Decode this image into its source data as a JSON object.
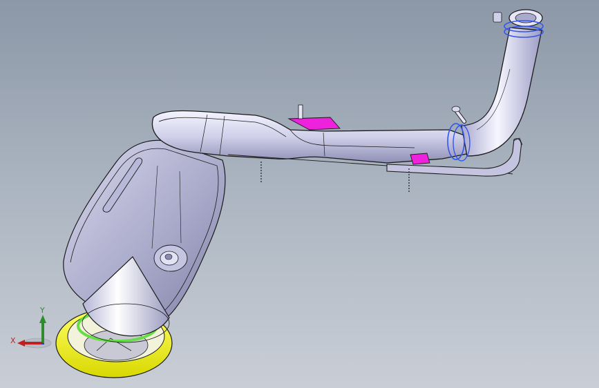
{
  "viewport": {
    "background_top": "#8c97a7",
    "background_bottom": "#c9ced6"
  },
  "model": {
    "body_color": "#d4d4ec",
    "edge_color": "#1a1a1a",
    "bracket_color": "#ee22dd",
    "clamp_color": "#3355ee",
    "ring_color": "#f0f010",
    "seal_color": "#66dd44"
  },
  "triad": {
    "x_label": "X",
    "y_label": "Y",
    "x_color": "#c02020",
    "y_color": "#2e8b2e",
    "z_color": "#2040d0"
  }
}
